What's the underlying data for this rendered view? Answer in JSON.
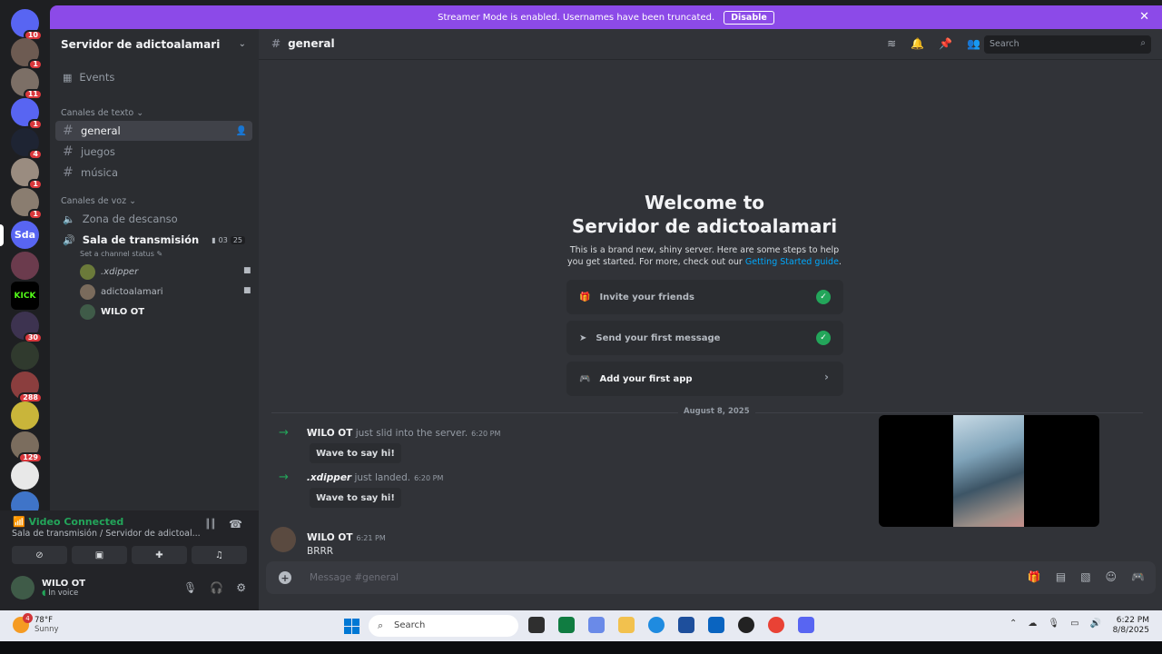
{
  "banner": {
    "text": "Streamer Mode is enabled. Usernames have been truncated.",
    "disable_label": "Disable",
    "close": "✕"
  },
  "rail": {
    "servers": [
      {
        "label": "",
        "badge": "10",
        "color": "#5865f2"
      },
      {
        "label": "",
        "badge": "1",
        "color": "#6d5b52"
      },
      {
        "label": "",
        "badge": "11",
        "color": "#7c6f66"
      },
      {
        "label": "",
        "badge": "1",
        "color": "#5865f2"
      },
      {
        "label": "",
        "badge": "4",
        "color": "#1e2433"
      },
      {
        "label": "",
        "badge": "1",
        "color": "#9a8c80"
      },
      {
        "label": "",
        "badge": "1",
        "color": "#8a7d70"
      },
      {
        "label": "Sda",
        "badge": "",
        "color": "#5865f2"
      },
      {
        "label": "",
        "badge": "",
        "color": "#6b3b4d"
      },
      {
        "label": "KICK",
        "badge": "",
        "color": "#000000"
      },
      {
        "label": "",
        "badge": "30",
        "color": "#3d3350"
      },
      {
        "label": "",
        "badge": "",
        "color": "#303a2e"
      },
      {
        "label": "",
        "badge": "288",
        "color": "#8b3e3e"
      },
      {
        "label": "",
        "badge": "",
        "color": "#c9b53a"
      },
      {
        "label": "",
        "badge": "129",
        "color": "#7b6d5e"
      },
      {
        "label": "",
        "badge": "",
        "color": "#e8e8e8"
      },
      {
        "label": "",
        "badge": "",
        "color": "#3f74c8"
      }
    ]
  },
  "sidebar": {
    "server_name": "Servidor de adictoalamari",
    "events_label": "Events",
    "text_category": "Canales de texto",
    "text_channels": [
      "general",
      "juegos",
      "música"
    ],
    "voice_category": "Canales de voz",
    "voice_channels": [
      "Zona de descanso",
      "Sala de transmisión"
    ],
    "voice_counts": {
      "users": "03",
      "limit": "25"
    },
    "channel_status": "Set a channel status",
    "voice_users": [
      ".xdipper",
      "adictoalamari",
      "WILO OT"
    ]
  },
  "voice_panel": {
    "status": "Video Connected",
    "location": "Sala de transmisión / Servidor de adictoal...",
    "user_name": "WILO OT",
    "user_status": "In voice"
  },
  "main": {
    "channel": "general",
    "search_placeholder": "Search",
    "welcome_line1": "Welcome to",
    "welcome_line2": "Servidor de adictoalamari",
    "welcome_sub": "This is a brand new, shiny server. Here are some steps to help you get started. For more, check out our",
    "welcome_link": "Getting Started guide",
    "steps": [
      "Invite your friends",
      "Send your first message",
      "Add your first app"
    ],
    "date_divider": "August 8, 2025",
    "events": [
      {
        "user": "WILO OT",
        "action": "just slid into the server.",
        "time": "6:20 PM",
        "button": "Wave to say hi!"
      },
      {
        "user": ".xdipper",
        "action": "just landed.",
        "time": "6:20 PM",
        "button": "Wave to say hi!"
      }
    ],
    "message": {
      "user": "WILO OT",
      "time": "6:21 PM",
      "text": "BRRR"
    },
    "composer_placeholder": "Message #general"
  },
  "taskbar": {
    "temp": "78°F",
    "weather": "Sunny",
    "weather_badge": "4",
    "search": "Search",
    "time": "6:22 PM",
    "date": "8/8/2025"
  }
}
